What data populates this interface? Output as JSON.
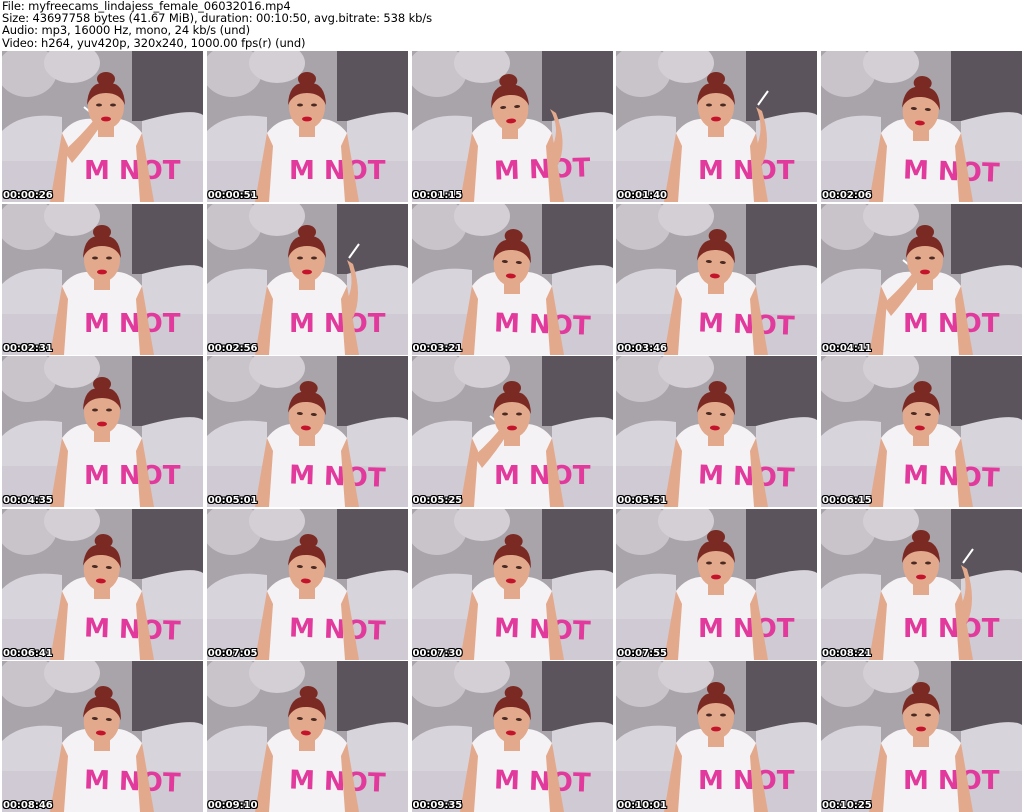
{
  "header": {
    "file_line": "File: myfreecams_lindajess_female_06032016.mp4",
    "size_line": "Size: 43697758 bytes (41.67 MiB), duration: 00:10:50, avg.bitrate: 538 kb/s",
    "audio_line": "Audio: mp3, 16000 Hz, mono, 24 kb/s (und)",
    "video_line": "Video: h264, yuv420p, 320x240, 1000.00 fps(r) (und)"
  },
  "frames": [
    {
      "timestamp": "00:00:26",
      "pose": "smoke"
    },
    {
      "timestamp": "00:00:51",
      "pose": "front"
    },
    {
      "timestamp": "00:01:15",
      "pose": "wave"
    },
    {
      "timestamp": "00:01:40",
      "pose": "smoke-right"
    },
    {
      "timestamp": "00:02:06",
      "pose": "down"
    },
    {
      "timestamp": "00:02:31",
      "pose": "front"
    },
    {
      "timestamp": "00:02:56",
      "pose": "smoke-right"
    },
    {
      "timestamp": "00:03:21",
      "pose": "down"
    },
    {
      "timestamp": "00:03:46",
      "pose": "down"
    },
    {
      "timestamp": "00:04:11",
      "pose": "smoke"
    },
    {
      "timestamp": "00:04:35",
      "pose": "front"
    },
    {
      "timestamp": "00:05:01",
      "pose": "down"
    },
    {
      "timestamp": "00:05:25",
      "pose": "hand-face"
    },
    {
      "timestamp": "00:05:51",
      "pose": "down"
    },
    {
      "timestamp": "00:06:15",
      "pose": "down"
    },
    {
      "timestamp": "00:06:41",
      "pose": "down"
    },
    {
      "timestamp": "00:07:05",
      "pose": "down"
    },
    {
      "timestamp": "00:07:30",
      "pose": "down"
    },
    {
      "timestamp": "00:07:55",
      "pose": "front"
    },
    {
      "timestamp": "00:08:21",
      "pose": "smoke-right"
    },
    {
      "timestamp": "00:08:46",
      "pose": "down"
    },
    {
      "timestamp": "00:09:10",
      "pose": "down"
    },
    {
      "timestamp": "00:09:35",
      "pose": "down"
    },
    {
      "timestamp": "00:10:01",
      "pose": "front"
    },
    {
      "timestamp": "00:10:25",
      "pose": "front"
    }
  ],
  "colors": {
    "background_wall": "#a9a3aa",
    "dark_panel": "#5b545c",
    "sofa": "#d8d4dc",
    "shirt": "#f4f2f4",
    "shirt_text": "#e23a9c",
    "skin": "#e2a98c",
    "hair": "#7a2a22",
    "lips": "#c4142c"
  }
}
